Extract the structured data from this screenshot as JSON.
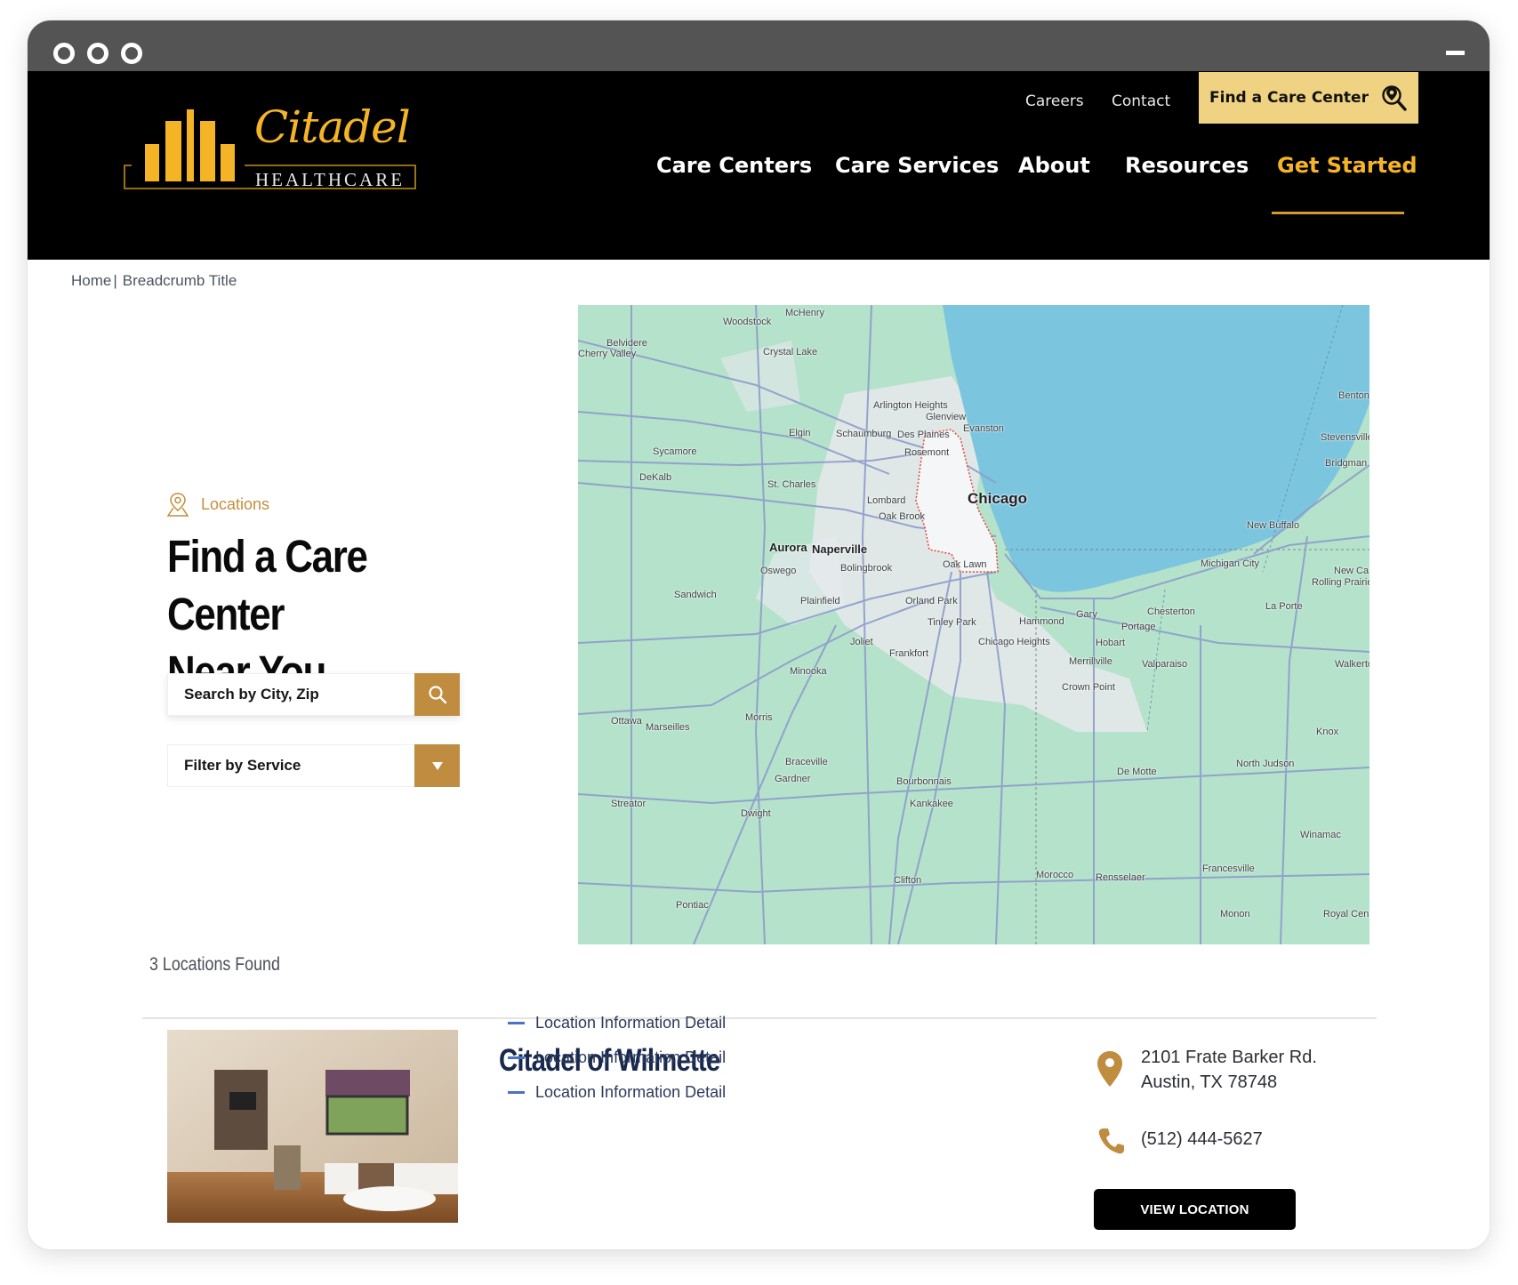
{
  "window": {
    "controls": [
      "close",
      "minimize",
      "maximize"
    ],
    "minimize_label": "minimize"
  },
  "brand": {
    "name": "Citadel",
    "subtitle": "HEALTHCARE",
    "gold": "#f4b425",
    "accent": "#c08c3f"
  },
  "header": {
    "top_links": [
      "Careers",
      "Contact"
    ],
    "find_button": "Find a Care Center",
    "nav": [
      "Care Centers",
      "Care Services",
      "About",
      "Resources",
      "Get Started"
    ],
    "active_nav": "Get Started"
  },
  "breadcrumb": {
    "home": "Home",
    "separator": "|",
    "current": "Breadcrumb Title"
  },
  "search_panel": {
    "eyebrow": "Locations",
    "heading_line1": "Find a Care Center",
    "heading_line2": "Near You",
    "search_placeholder": "Search by City, Zip",
    "filter_label": "Filter by Service"
  },
  "map": {
    "labels_big": [
      "Chicago"
    ],
    "labels_mid": [
      "Aurora",
      "Naperville"
    ],
    "labels": [
      "McHenry",
      "Woodstock",
      "Belvidere",
      "Cherry Valley",
      "Crystal Lake",
      "Arlington Heights",
      "Glenview",
      "Evanston",
      "Elgin",
      "Schaumburg",
      "Des Plaines",
      "Rosemont",
      "Sycamore",
      "DeKalb",
      "St. Charles",
      "Lombard",
      "Oak Brook",
      "Oswego",
      "Bolingbrook",
      "Oak Lawn",
      "Sandwich",
      "Plainfield",
      "Orland Park",
      "Tinley Park",
      "Hammond",
      "Gary",
      "Joliet",
      "Frankfort",
      "Chicago Heights",
      "Hobart",
      "Portage",
      "Chesterton",
      "Merrillville",
      "Valparaiso",
      "Minooka",
      "Crown Point",
      "Morris",
      "Ottawa",
      "Marseilles",
      "Braceville",
      "Gardner",
      "Bourbonnais",
      "Kankakee",
      "Dwight",
      "Streator",
      "Clifton",
      "Pontiac",
      "Morocco",
      "Rensselaer",
      "De Motte",
      "Francesville",
      "Monon",
      "Winamac",
      "North Judson",
      "Knox",
      "Benton",
      "Stevensville",
      "Bridgman",
      "New Buffalo",
      "Michigan City",
      "New Carlisle",
      "Rolling Prairie",
      "La Porte",
      "Walkerton",
      "Royal Center"
    ]
  },
  "results": {
    "count_text": "3 Locations Found",
    "items": [
      {
        "name": "Citadel of Wilmette",
        "details": [
          "Location Information Detail",
          "Location Information Detail",
          "Location Information Detail"
        ],
        "address_line1": "2101 Frate Barker Rd.",
        "address_line2": "Austin, TX 78748",
        "phone": "(512) 444-5627",
        "button": "VIEW LOCATION"
      }
    ]
  }
}
